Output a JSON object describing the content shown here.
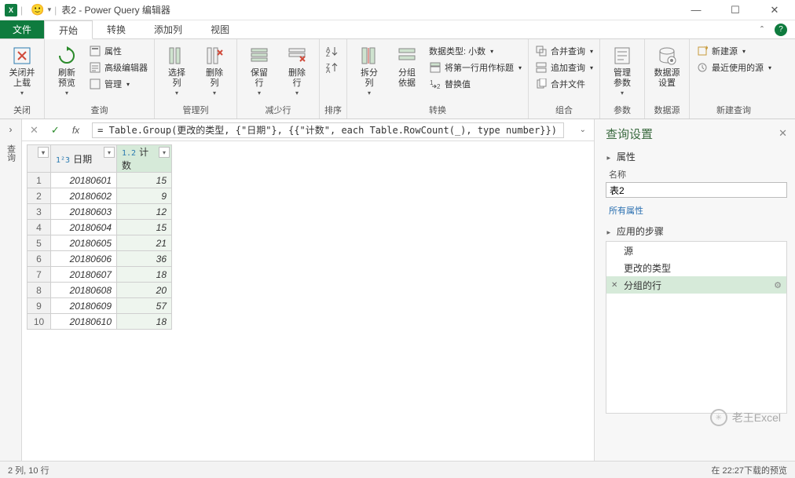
{
  "window": {
    "title": "表2 - Power Query 编辑器",
    "smiley": "🙂"
  },
  "tabs": {
    "file": "文件",
    "home": "开始",
    "transform": "转换",
    "addcol": "添加列",
    "view": "视图"
  },
  "ribbon": {
    "close_group": "关闭",
    "close_load": "关闭并\n上载",
    "query_group": "查询",
    "refresh": "刷新\n预览",
    "properties": "属性",
    "adv_editor": "高级编辑器",
    "manage": "管理",
    "cols_group": "管理列",
    "choose_cols": "选择\n列",
    "remove_cols": "删除\n列",
    "rows_group": "减少行",
    "keep_rows": "保留\n行",
    "remove_rows": "删除\n行",
    "sort_group": "排序",
    "transform_group": "转换",
    "split": "拆分\n列",
    "groupby": "分组\n依据",
    "datatype": "数据类型: 小数",
    "firstrow": "将第一行用作标题",
    "replace": "替换值",
    "combine_group": "组合",
    "merge": "合并查询",
    "append": "追加查询",
    "combine_files": "合并文件",
    "param_group": "参数",
    "manage_param": "管理\n参数",
    "ds_group": "数据源",
    "ds_settings": "数据源\n设置",
    "newq_group": "新建查询",
    "new_source": "新建源",
    "recent": "最近使用的源"
  },
  "nav_label": "查询",
  "formula": "= Table.Group(更改的类型, {\"日期\"}, {{\"计数\", each Table.RowCount(_), type number}})",
  "columns": {
    "c1_icon": "1²3",
    "c1_name": "日期",
    "c2_icon": "1.2",
    "c2_name": "计数"
  },
  "rows": [
    {
      "n": 1,
      "d": "20180601",
      "c": "15"
    },
    {
      "n": 2,
      "d": "20180602",
      "c": "9"
    },
    {
      "n": 3,
      "d": "20180603",
      "c": "12"
    },
    {
      "n": 4,
      "d": "20180604",
      "c": "15"
    },
    {
      "n": 5,
      "d": "20180605",
      "c": "21"
    },
    {
      "n": 6,
      "d": "20180606",
      "c": "36"
    },
    {
      "n": 7,
      "d": "20180607",
      "c": "18"
    },
    {
      "n": 8,
      "d": "20180608",
      "c": "20"
    },
    {
      "n": 9,
      "d": "20180609",
      "c": "57"
    },
    {
      "n": 10,
      "d": "20180610",
      "c": "18"
    }
  ],
  "settings": {
    "title": "查询设置",
    "props": "属性",
    "name_label": "名称",
    "name_value": "表2",
    "all_props": "所有属性",
    "steps_label": "应用的步骤",
    "steps": [
      {
        "label": "源",
        "sel": false
      },
      {
        "label": "更改的类型",
        "sel": false
      },
      {
        "label": "分组的行",
        "sel": true
      }
    ]
  },
  "watermark": "老王Excel",
  "status": {
    "left": "2 列, 10 行",
    "right": "在 22:27下载的预览"
  }
}
